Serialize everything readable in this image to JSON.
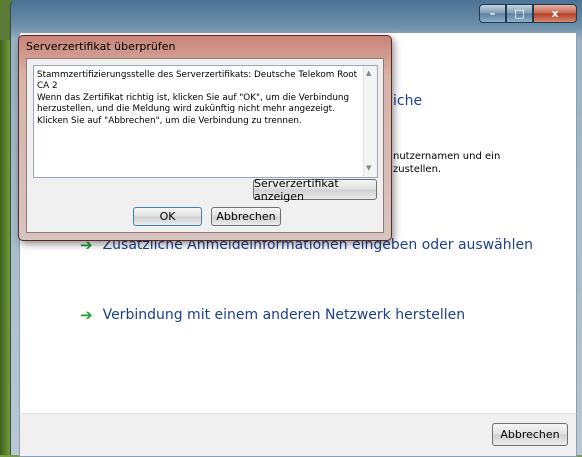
{
  "main_window": {
    "title_buttons": {
      "minimize": "–",
      "maximize": "□",
      "close": "x"
    },
    "partial_heading": "iche",
    "partial_text_line1": "nutzernamen und ein",
    "partial_text_line2": "zustellen.",
    "links": [
      {
        "label": "Zusätzliche Anmeldeinformationen eingeben oder auswählen"
      },
      {
        "label": "Verbindung mit einem anderen Netzwerk herstellen"
      }
    ],
    "cancel_label": "Abbrechen"
  },
  "dialog": {
    "title": "Serverzertifikat überprüfen",
    "message_line1": "Stammzertifizierungsstelle des Serverzertifikats: Deutsche Telekom Root",
    "message_line2": "CA 2",
    "message_line3": "Wenn das Zertifikat richtig ist, klicken Sie auf \"OK\", um die Verbindung",
    "message_line4": "herzustellen, und die Meldung wird zukünftig nicht mehr angezeigt.",
    "message_line5": "Klicken Sie auf \"Abbrechen\", um die Verbindung zu trennen.",
    "show_cert_label": "Serverzertifikat anzeigen",
    "ok_label": "OK",
    "cancel_label": "Abbrechen"
  },
  "icons": {
    "link_arrow": "green-right-arrow-icon",
    "scroll_up": "scroll-up-icon",
    "scroll_down": "scroll-down-icon"
  }
}
